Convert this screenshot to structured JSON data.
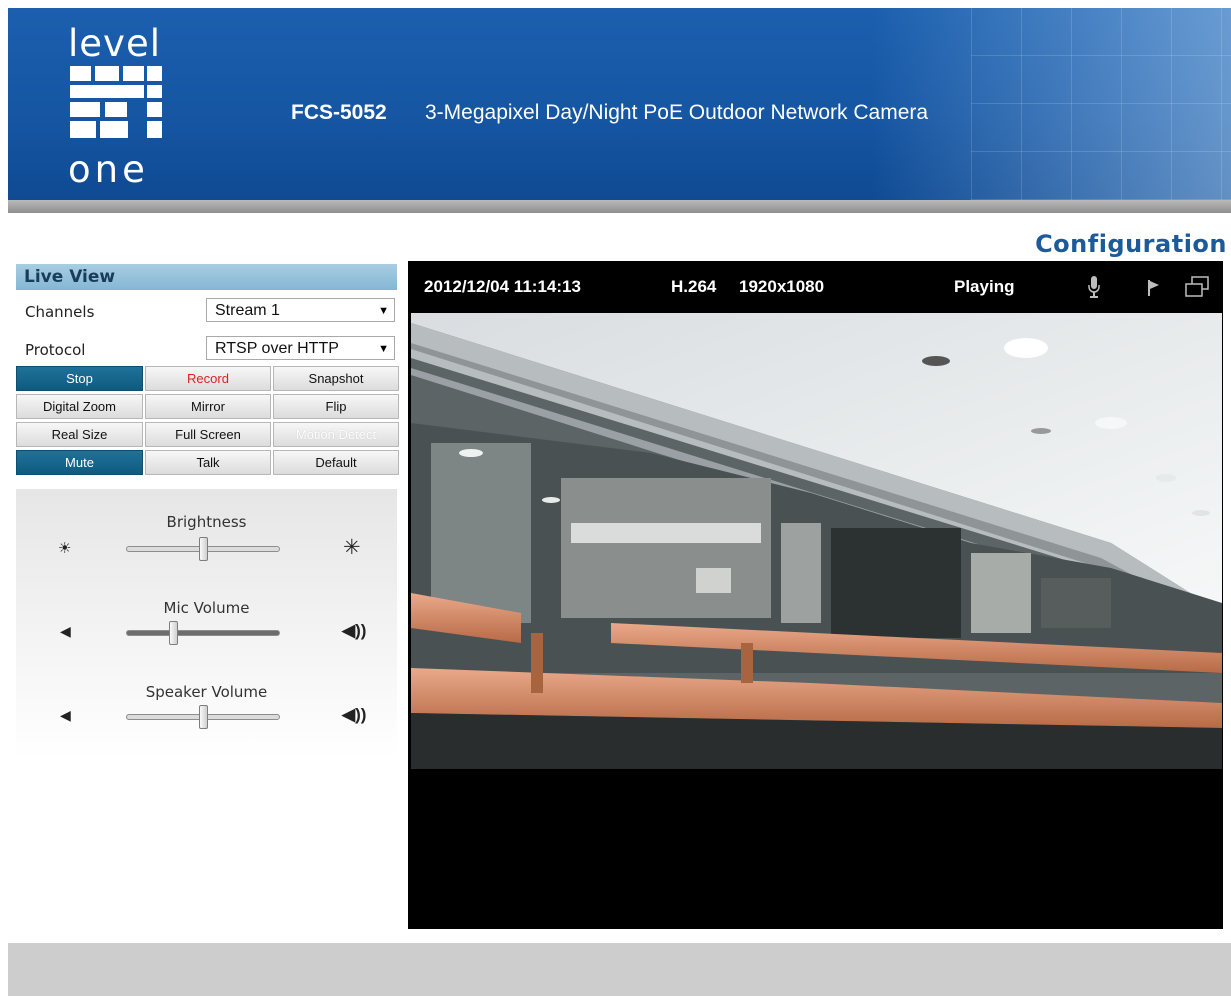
{
  "header": {
    "logo_top": "level",
    "logo_bottom": "one",
    "model": "FCS-5052",
    "description": "3-Megapixel Day/Night PoE Outdoor Network Camera"
  },
  "config_link": "Configuration",
  "panel": {
    "title": "Live View",
    "channels_label": "Channels",
    "channels_value": "Stream 1",
    "protocol_label": "Protocol",
    "protocol_value": "RTSP over HTTP",
    "buttons": {
      "stop": "Stop",
      "record": "Record",
      "snapshot": "Snapshot",
      "digital_zoom": "Digital Zoom",
      "mirror": "Mirror",
      "flip": "Flip",
      "real_size": "Real Size",
      "full_screen": "Full Screen",
      "motion_detect": "Motion Detect",
      "mute": "Mute",
      "talk": "Talk",
      "default": "Default"
    },
    "sliders": {
      "brightness_label": "Brightness",
      "brightness_level": 0.5,
      "mic_label": "Mic Volume",
      "mic_level": 0.3,
      "speaker_label": "Speaker Volume",
      "speaker_level": 0.5
    }
  },
  "video": {
    "datetime": "2012/12/04 11:14:13",
    "codec": "H.264",
    "resolution": "1920x1080",
    "status": "Playing"
  },
  "colors": {
    "header_blue": "#1656a3",
    "active_button": "#0f5a7f",
    "config_link": "#1d5a9a",
    "record_red": "#e02020"
  }
}
